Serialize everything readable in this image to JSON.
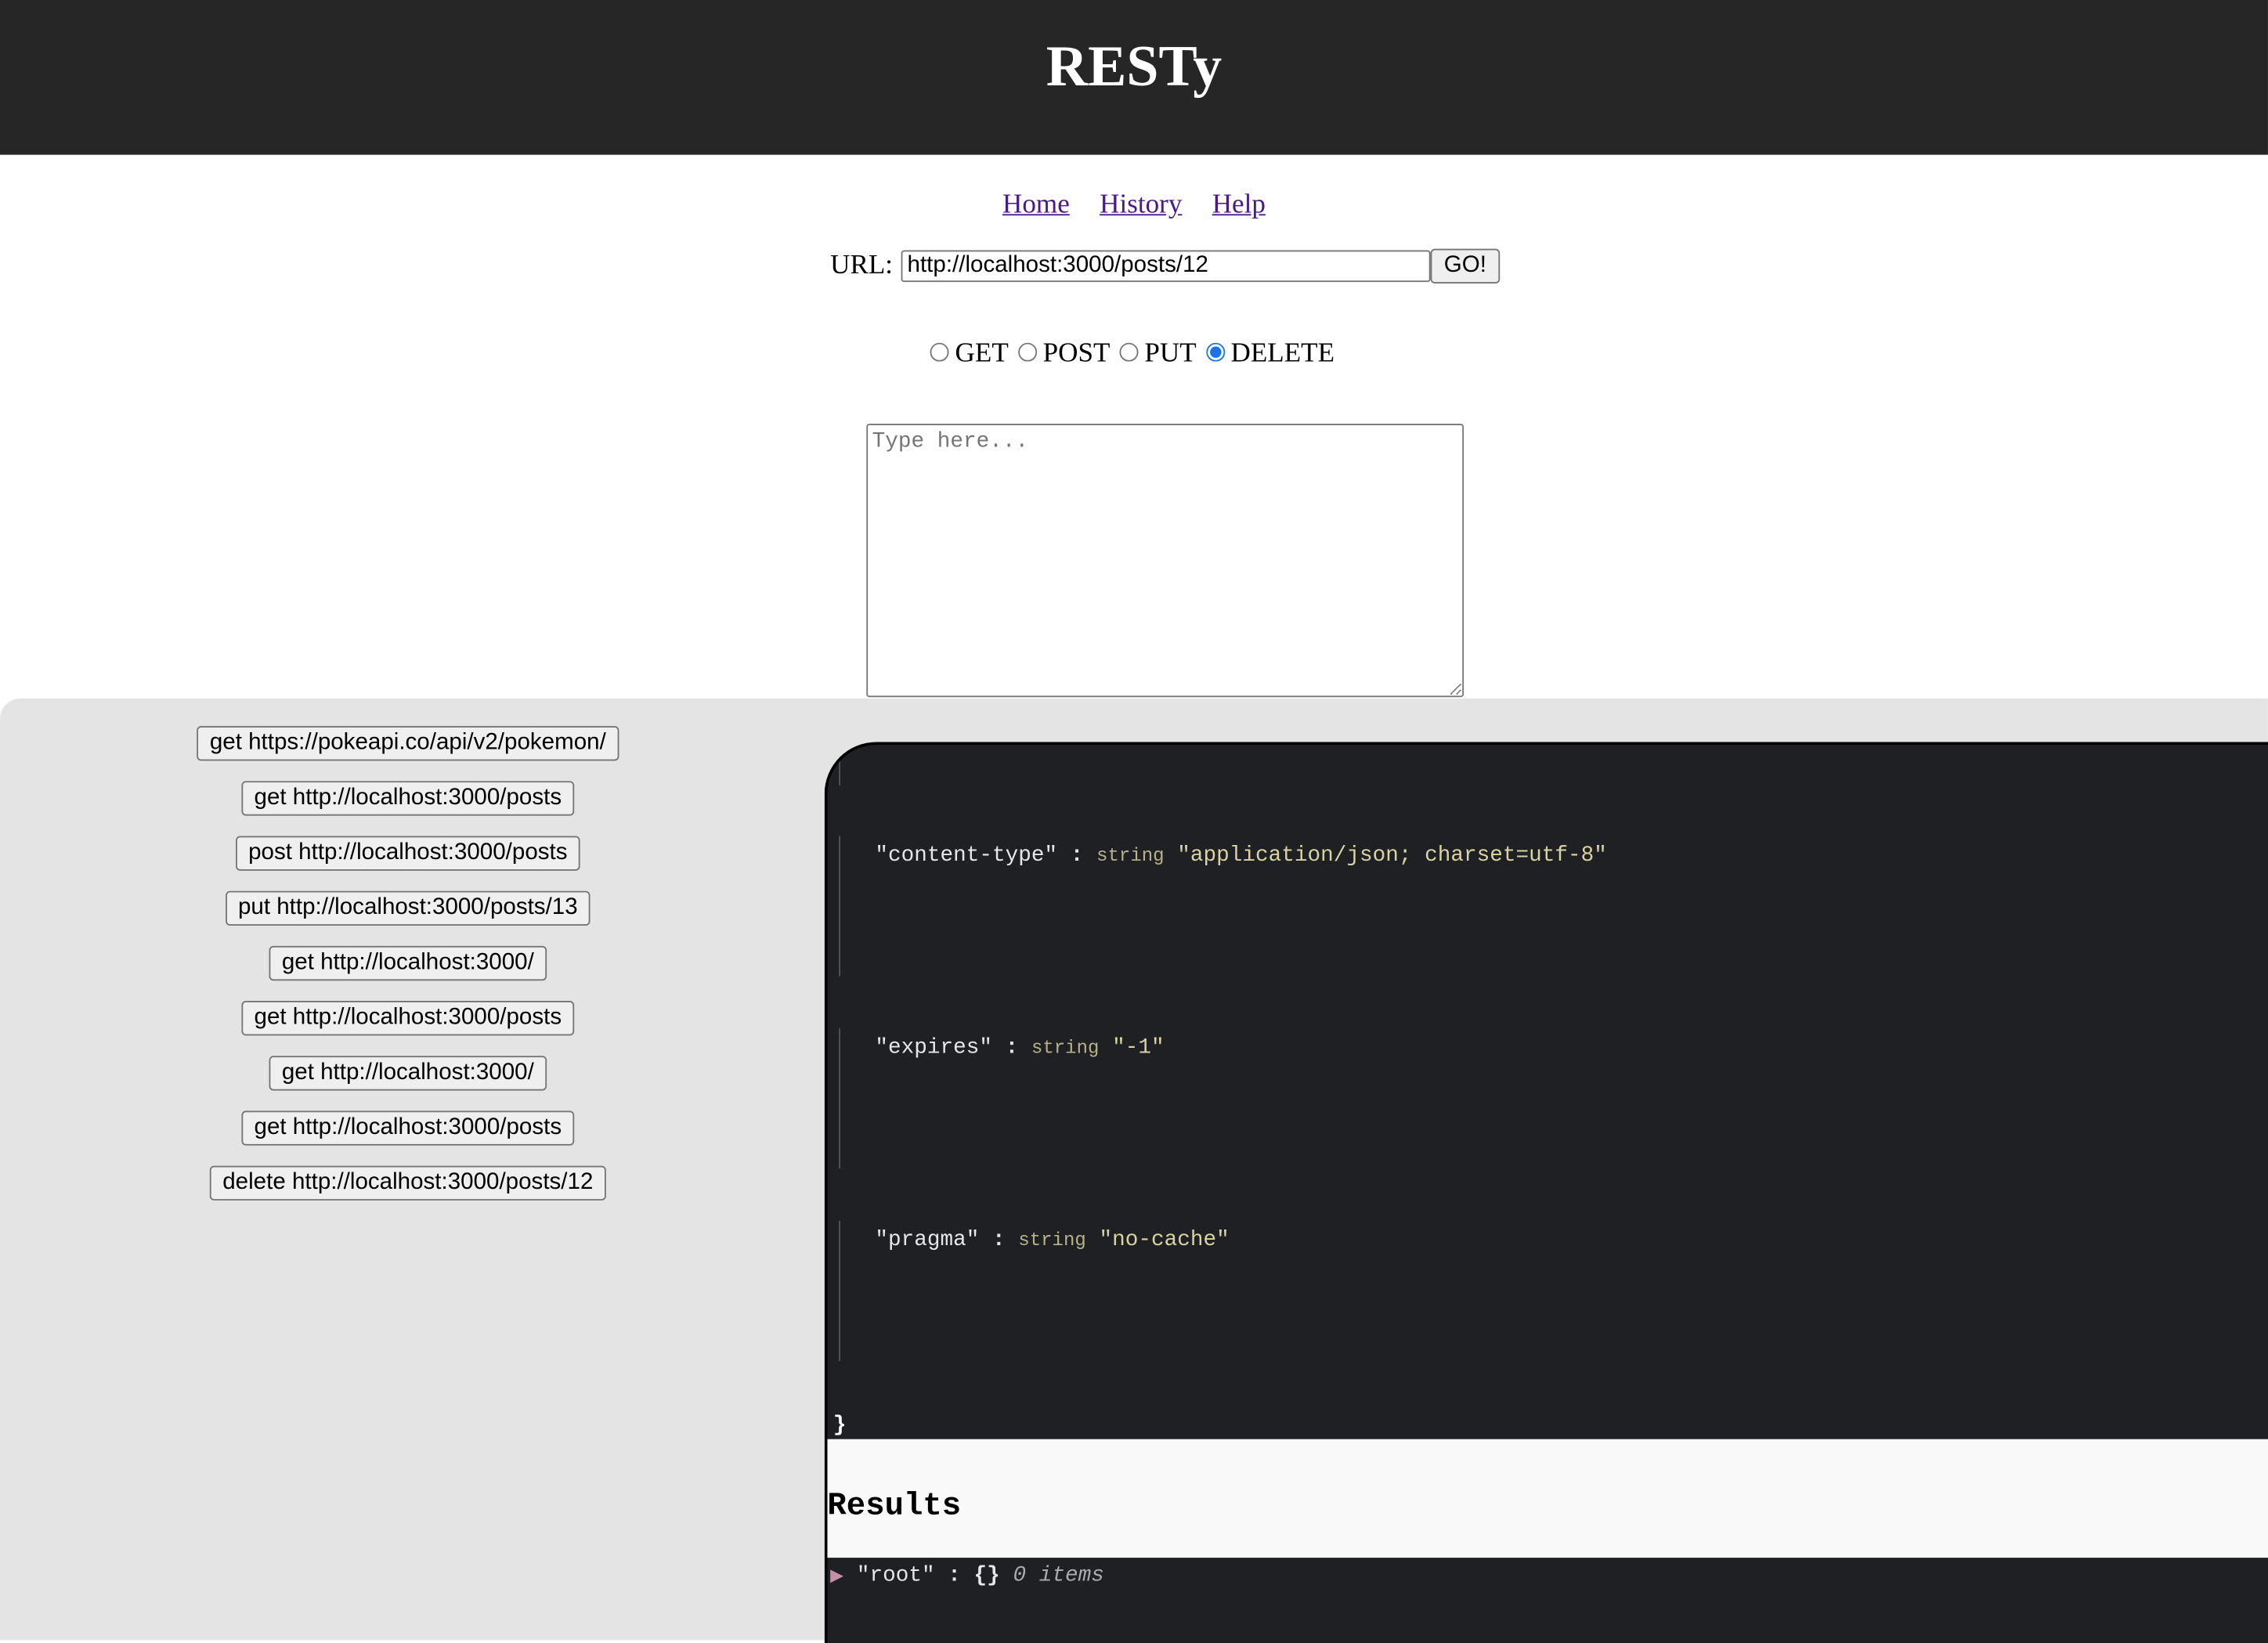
{
  "header": {
    "title": "RESTy"
  },
  "nav": {
    "home": "Home",
    "history": "History",
    "help": "Help"
  },
  "form": {
    "url_label": "URL:",
    "url_value": "http://localhost:3000/posts/12",
    "go_label": "GO!",
    "methods": [
      "GET",
      "POST",
      "PUT",
      "DELETE"
    ],
    "selected_method": "DELETE",
    "body_placeholder": "Type here..."
  },
  "history": [
    "get https://pokeapi.co/api/v2/pokemon/",
    "get http://localhost:3000/posts",
    "post http://localhost:3000/posts",
    "put http://localhost:3000/posts/13",
    "get http://localhost:3000/",
    "get http://localhost:3000/posts",
    "get http://localhost:3000/",
    "get http://localhost:3000/posts",
    "delete http://localhost:3000/posts/12"
  ],
  "headers_view": {
    "rows": [
      {
        "key": "\"content-type\"",
        "sep": ":",
        "type": "string",
        "value": "\"application/json; charset=utf-8\""
      },
      {
        "key": "\"expires\"",
        "sep": ":",
        "type": "string",
        "value": "\"-1\""
      },
      {
        "key": "\"pragma\"",
        "sep": ":",
        "type": "string",
        "value": "\"no-cache\""
      }
    ],
    "closing": "}"
  },
  "results": {
    "heading": "Results",
    "root_key": "\"root\"",
    "sep": ":",
    "root_value": "{}",
    "count": "0 items"
  }
}
